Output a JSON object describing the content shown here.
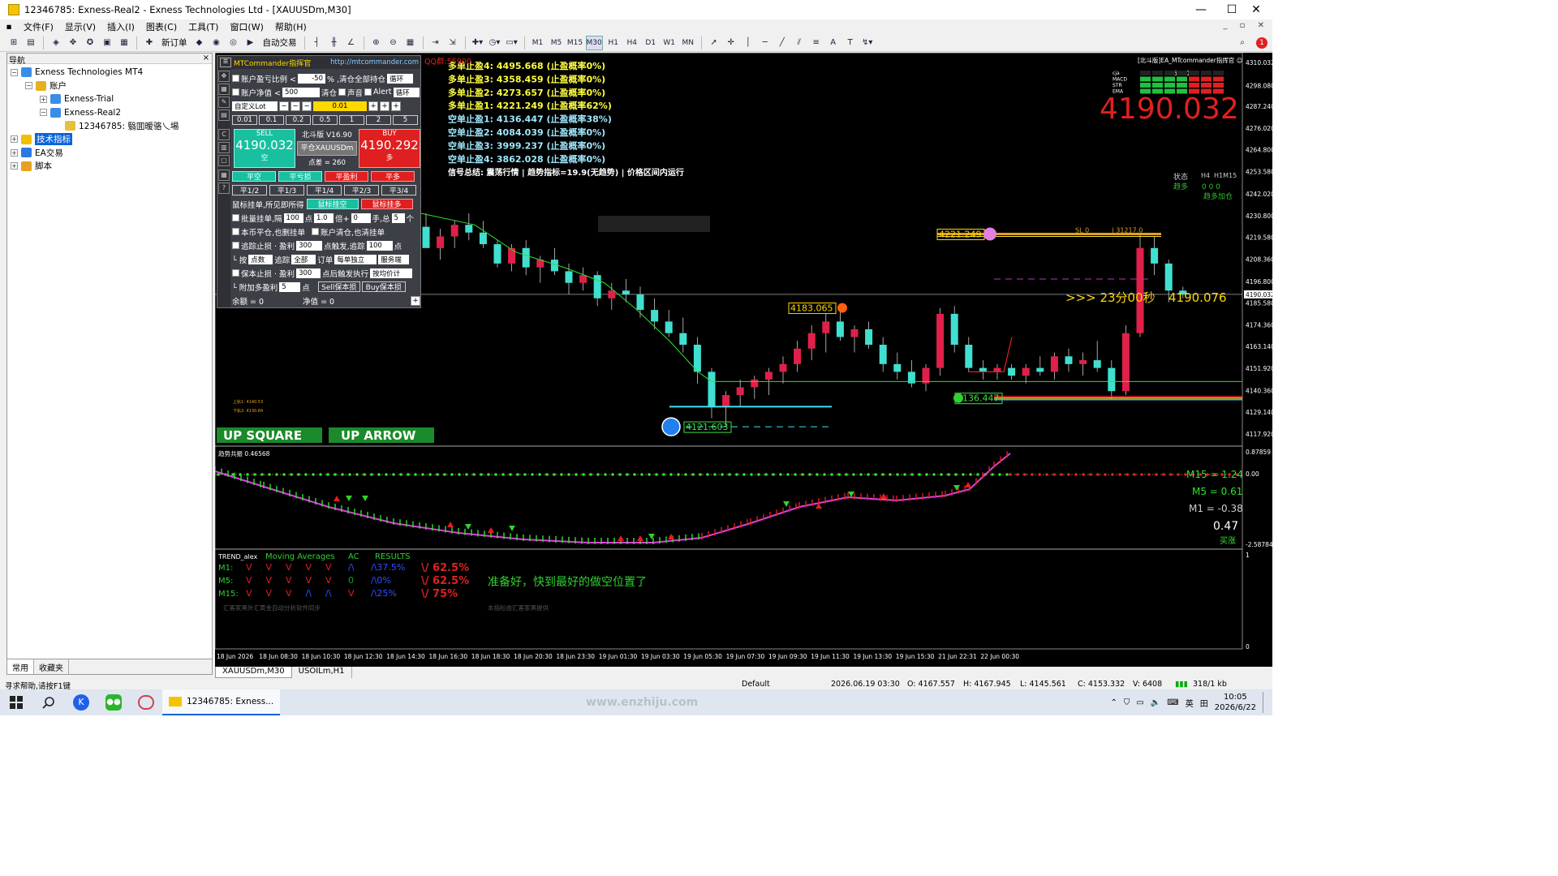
{
  "window": {
    "title": "12346785: Exness-Real2 - Exness Technologies Ltd - [XAUUSDm,M30]",
    "min": "—",
    "max": "☐",
    "close": "✕"
  },
  "menu": [
    "文件(F)",
    "显示(V)",
    "插入(I)",
    "图表(C)",
    "工具(T)",
    "窗口(W)",
    "帮助(H)"
  ],
  "toolbar": {
    "new_order": "新订单",
    "auto_trade": "自动交易",
    "timeframes": [
      "M1",
      "M5",
      "M15",
      "M30",
      "H1",
      "H4",
      "D1",
      "W1",
      "MN"
    ],
    "active_tf": "M30"
  },
  "navigator": {
    "title": "导航",
    "close": "×",
    "items": [
      {
        "label": "Exness Technologies MT4",
        "level": 0,
        "ex": "−"
      },
      {
        "label": "账户",
        "level": 1,
        "ex": "−"
      },
      {
        "label": "Exness-Trial",
        "level": 2,
        "ex": "+"
      },
      {
        "label": "Exness-Real2",
        "level": 2,
        "ex": "−"
      },
      {
        "label": "12346785: 翳囬暧骆乀埸",
        "level": 3,
        "ex": ""
      },
      {
        "label": "技术指标",
        "level": 0,
        "ex": "+",
        "selected": true
      },
      {
        "label": "EA交易",
        "level": 0,
        "ex": "+"
      },
      {
        "label": "脚本",
        "level": 0,
        "ex": "+"
      }
    ],
    "tabs": [
      "常用",
      "收藏夹"
    ]
  },
  "panel": {
    "title": "MTCommander指挥官",
    "url": "http://mtcommander.com",
    "qq": "QQ群:55900",
    "r1_label": "账户盈亏比例 <",
    "r1_val": "-50",
    "r1_tail": "% ,清仓全部持仓",
    "r1_sel": "循环",
    "r2_label": "账户净值 <",
    "r2_val": "500",
    "r2_a": "清仓",
    "r2_b": "声音",
    "r2_c": "Alert",
    "r2_sel": "循环",
    "lot_sel": "自定义Lot",
    "lot_val": "0.01",
    "lots": [
      "0.01",
      "0.1",
      "0.2",
      "0.5",
      "1",
      "2",
      "5"
    ],
    "sell_lbl": "SELL",
    "sell_price": "4190.032",
    "sell_sub": "空",
    "ver": "北斗版 V16.90",
    "close_sym": "平仓XAUUSDm",
    "spread": "点差 = 260",
    "buy_lbl": "BUY",
    "buy_price": "4190.292",
    "buy_sub": "多",
    "c1": [
      "平空",
      "平亏损",
      "平盈利",
      "平多"
    ],
    "c2": [
      "平1/2",
      "平1/3",
      "平1/4",
      "平2/3",
      "平3/4"
    ],
    "mouse_lbl": "鼠标挂单,所见即所得",
    "mouse_sell": "鼠标挂空",
    "mouse_buy": "鼠标挂多",
    "batch": "批量挂单,隔",
    "batch_v1": "100",
    "batch_pt": "点",
    "batch_v2": "1.0",
    "batch_x": "倍+",
    "batch_v3": "0",
    "batch_hand": "手,总",
    "batch_v4": "5",
    "batch_n": "个",
    "opt1": "本币平仓,也删挂单",
    "opt2": "账户清仓,也清挂单",
    "trail": "追踪止损 · 盈利",
    "trail_v": "300",
    "trail_m": "点触发,追踪",
    "trail_v2": "100",
    "trail_pt": "点",
    "by": "└ 按",
    "by_sel": "点数",
    "track": "追踪",
    "track_sel": "全部",
    "order": "订单",
    "order_sel": "每单独立",
    "srv_sel": "服务端",
    "be": "保本止损 · 盈利",
    "be_v": "300",
    "be_m": "点后触发执行",
    "be_sel": "按均价计",
    "extra": "└ 附加多盈利",
    "extra_v": "5",
    "extra_pt": "点",
    "sell_be": "Sell保本损",
    "buy_be": "Buy保本损",
    "bal": "余额 = 0",
    "eq": "净值 = 0",
    "plus": "+"
  },
  "targets": [
    {
      "t": "多单止盈4: 4495.668 (止盈概率0%)",
      "c": "#ffff40"
    },
    {
      "t": "多单止盈3: 4358.459 (止盈概率0%)",
      "c": "#ffff40"
    },
    {
      "t": "多单止盈2: 4273.657 (止盈概率0%)",
      "c": "#ffff40"
    },
    {
      "t": "多单止盈1: 4221.249 (止盈概率62%)",
      "c": "#ffff40"
    },
    {
      "t": "空单止盈1: 4136.447 (止盈概率38%)",
      "c": "#a0e8ff"
    },
    {
      "t": "空单止盈2: 4084.039 (止盈概率0%)",
      "c": "#a0e8ff"
    },
    {
      "t": "空单止盈3: 3999.237 (止盈概率0%)",
      "c": "#a0e8ff"
    },
    {
      "t": "空单止盈4: 3862.028 (止盈概率0%)",
      "c": "#a0e8ff"
    },
    {
      "t": "信号总结: 震荡行情 | 趋势指标=19.9(无趋势) | 价格区间内运行",
      "c": "#ffffff"
    }
  ],
  "topright": {
    "ea": "[北斗版]EA_MTcommander指挥官 ☺",
    "tfs": [
      "M1",
      "M5",
      "M15",
      "M30",
      "H1",
      "H4",
      "D1"
    ],
    "rows": [
      "cja",
      "MACD",
      "STR",
      "EMA"
    ],
    "big_price": "4190.032",
    "state": "状态",
    "h4": "H4",
    "h1m15": "H1M15",
    "long": "趋多",
    "zeros": "0  0  0",
    "add": "趋多加仓"
  },
  "annot": {
    "p1": "4221.249",
    "p2": "4183.065",
    "p3": "4136.447",
    "p4": "4121.603",
    "sl": "SL  0",
    "slv": "| 31217.0",
    "timer": ">>> 23分00秒",
    "timer_price": "4190.076",
    "left1": "上轨1: 4140.53",
    "left2": "下轨2: 4130.84"
  },
  "buttons": {
    "up_square": "UP SQUARE",
    "up_arrow": "UP ARROW"
  },
  "price_axis": [
    "4310.032",
    "4298.080",
    "4287.240",
    "4276.020",
    "4264.800",
    "4253.580",
    "4242.020",
    "4230.800",
    "4219.580",
    "4208.360",
    "4196.800",
    "4190.032",
    "4185.580",
    "4174.360",
    "4163.140",
    "4151.920",
    "4140.360",
    "4129.140",
    "4117.920"
  ],
  "sub1": {
    "name": "趋势共振 0.46568",
    "m15": "M15 = 1.24",
    "m5": "M5 = 0.61",
    "m1": "M1 = -0.38",
    "val": "0.47",
    "buy": "买涨",
    "ax_top": "0.87859",
    "ax_mid": "0.00",
    "ax_bot": "-2.58784"
  },
  "sub2": {
    "name": "TREND_alex",
    "h_ma": "Moving Averages",
    "h_ac": "AC",
    "h_res": "RESULTS",
    "rows": [
      {
        "tf": "M1:",
        "v": [
          "V",
          "V",
          "V",
          "V",
          "V"
        ],
        "vc": [
          "#e02020",
          "#e02020",
          "#e02020",
          "#e02020",
          "#e02020"
        ],
        "ac": "/\\",
        "acc": "#3050ff",
        "r1": "/\\37.5%",
        "r2": "\\/ 62.5%"
      },
      {
        "tf": "M5:",
        "v": [
          "V",
          "V",
          "V",
          "V",
          "V"
        ],
        "vc": [
          "#e02020",
          "#e02020",
          "#e02020",
          "#e02020",
          "#e02020"
        ],
        "ac": "0",
        "acc": "#10a020",
        "r1": "/\\0%",
        "r2": "\\/ 62.5%"
      },
      {
        "tf": "M15:",
        "v": [
          "V",
          "V",
          "V",
          "/\\",
          "/\\"
        ],
        "vc": [
          "#e02020",
          "#e02020",
          "#e02020",
          "#3050ff",
          "#3050ff"
        ],
        "ac": "V",
        "acc": "#e02020",
        "r1": "/\\25%",
        "r2": "\\/ 75%"
      }
    ],
    "msg": "准备好，快到最好的做空位置了",
    "foot1": "汇客家黑外汇黄金自动分析软件同步",
    "foot2": "本指标由汇客家黑提供",
    "ax1": "1",
    "ax0": "0"
  },
  "time_axis": [
    "18 Jun 2026",
    "18 Jun 08:30",
    "18 Jun 10:30",
    "18 Jun 12:30",
    "18 Jun 14:30",
    "18 Jun 16:30",
    "18 Jun 18:30",
    "18 Jun 20:30",
    "18 Jun 23:30",
    "19 Jun 01:30",
    "19 Jun 03:30",
    "19 Jun 05:30",
    "19 Jun 07:30",
    "19 Jun 09:30",
    "19 Jun 11:30",
    "19 Jun 13:30",
    "19 Jun 15:30",
    "21 Jun 22:31",
    "22 Jun 00:30"
  ],
  "chart_tabs": [
    "XAUUSDm,M30",
    "USOILm,H1"
  ],
  "status": {
    "help": "寻求帮助,请按F1键",
    "profile": "Default",
    "dt": "2026.06.19 03:30",
    "o": "O: 4167.557",
    "h": "H: 4167.945",
    "l": "L: 4145.561",
    "c": "C: 4153.332",
    "v": "V: 6408",
    "kb": "318/1 kb"
  },
  "taskbar": {
    "app": "12346785: Exness...",
    "time": "10:05",
    "date": "2026/6/22",
    "ime": "英",
    "watermark": "www.enzhiju.com"
  }
}
